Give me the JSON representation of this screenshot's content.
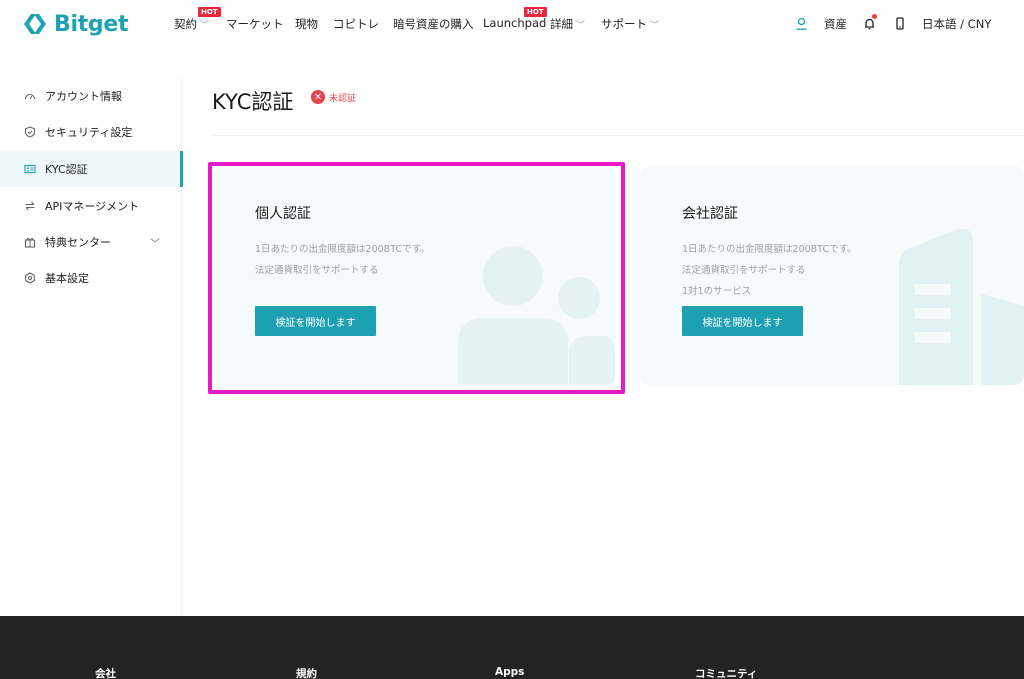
{
  "brand": {
    "name": "Bitget",
    "color": "#1da2b4"
  },
  "nav": {
    "items": [
      {
        "label": "契約",
        "hot": "HOT",
        "has_menu": true
      },
      {
        "label": "マーケット"
      },
      {
        "label": "現物"
      },
      {
        "label": "コピトレ"
      },
      {
        "label": "暗号資産の購入"
      },
      {
        "label": "Launchpad",
        "hot": "HOT"
      },
      {
        "label": "詳細",
        "has_menu": true
      },
      {
        "label": "サポート",
        "has_menu": true
      }
    ]
  },
  "header_right": {
    "assets_label": "資産",
    "language_label": "日本語 / CNY"
  },
  "sidebar": {
    "items": [
      {
        "label": "アカウント情報",
        "icon": "dashboard-icon"
      },
      {
        "label": "セキュリティ設定",
        "icon": "shield-icon"
      },
      {
        "label": "KYC認証",
        "icon": "id-card-icon",
        "active": true
      },
      {
        "label": "APIマネージメント",
        "icon": "api-arrows-icon"
      },
      {
        "label": "特典センター",
        "icon": "gift-icon",
        "has_menu": true
      },
      {
        "label": "基本設定",
        "icon": "gear-icon"
      }
    ]
  },
  "main": {
    "title": "KYC認証",
    "status": "未認証",
    "cards": {
      "personal": {
        "title": "個人認証",
        "lines": [
          "1日あたりの出金限度額は200BTCです。",
          "法定通貨取引をサポートする"
        ],
        "button": "検証を開始します"
      },
      "company": {
        "title": "会社認証",
        "lines": [
          "1日あたりの出金限度額は200BTCです。",
          "法定通貨取引をサポートする",
          "1対1のサービス"
        ],
        "button": "検証を開始します"
      }
    }
  },
  "footer": {
    "columns": [
      "会社",
      "規約",
      "Apps",
      "コミュニティ"
    ]
  },
  "colors": {
    "accent": "#1ca0b2",
    "highlight": "#e81ac6",
    "error": "#e8424b",
    "hot": "#e8263c",
    "footer_bg": "#232323"
  }
}
